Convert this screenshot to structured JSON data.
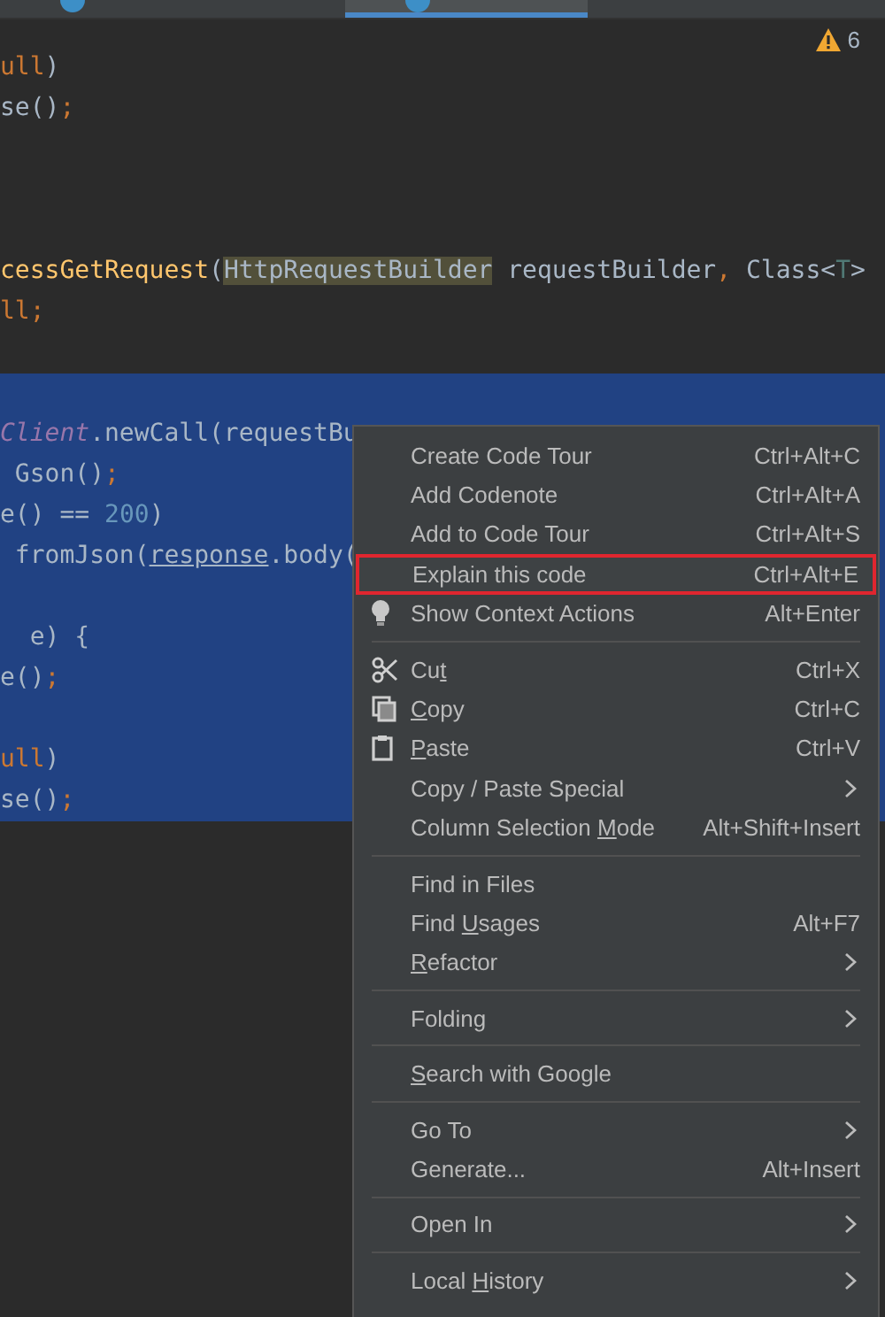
{
  "tabs": [
    {
      "selected": false
    },
    {
      "selected": true
    }
  ],
  "inspections": {
    "count": "6"
  },
  "editor": {
    "lines": [
      {
        "selected": false,
        "segments": [
          {
            "t": "ull",
            "kind": "keyword"
          },
          {
            "t": ")",
            "kind": "plain"
          }
        ]
      },
      {
        "selected": false,
        "segments": [
          {
            "t": "se()",
            "kind": "plain"
          },
          {
            "t": ";",
            "kind": "keyword"
          }
        ]
      },
      {
        "selected": false
      },
      {
        "selected": false
      },
      {
        "selected": false
      },
      {
        "selected": false,
        "segments": [
          {
            "t": "cessGetRequest",
            "kind": "method"
          },
          {
            "t": "(",
            "kind": "plain"
          },
          {
            "t": "HttpRequestBuilder",
            "kind": "highlight"
          },
          {
            "t": " requestBuilder",
            "kind": "plain"
          },
          {
            "t": ",",
            "kind": "keyword"
          },
          {
            "t": " Class<",
            "kind": "plain"
          },
          {
            "t": "T",
            "kind": "typeparam"
          },
          {
            "t": ">",
            "kind": "plain"
          }
        ]
      },
      {
        "selected": false,
        "segments": [
          {
            "t": "ll;",
            "kind": "keyword"
          }
        ]
      },
      {
        "selected": false
      },
      {
        "selected": true
      },
      {
        "selected": true,
        "segments": [
          {
            "t": "Client",
            "kind": "field"
          },
          {
            "t": ".newCall(requestBu",
            "kind": "plain"
          }
        ]
      },
      {
        "selected": true,
        "segments": [
          {
            "t": " Gson()",
            "kind": "plain"
          },
          {
            "t": ";",
            "kind": "keyword"
          }
        ]
      },
      {
        "selected": true,
        "segments": [
          {
            "t": "e() == ",
            "kind": "plain"
          },
          {
            "t": "200",
            "kind": "number"
          },
          {
            "t": ")",
            "kind": "plain"
          }
        ]
      },
      {
        "selected": true,
        "segments": [
          {
            "t": " fromJson(",
            "kind": "plain"
          },
          {
            "t": "response",
            "kind": "underlined"
          },
          {
            "t": ".body(",
            "kind": "plain"
          }
        ]
      },
      {
        "selected": true
      },
      {
        "selected": true,
        "segments": [
          {
            "t": "  e) {",
            "kind": "plain"
          }
        ]
      },
      {
        "selected": true,
        "segments": [
          {
            "t": "e()",
            "kind": "plain"
          },
          {
            "t": ";",
            "kind": "keyword"
          }
        ]
      },
      {
        "selected": true
      },
      {
        "selected": true,
        "segments": [
          {
            "t": "ull",
            "kind": "keyword"
          },
          {
            "t": ")",
            "kind": "plain"
          }
        ]
      },
      {
        "selected": true,
        "segments": [
          {
            "t": "se()",
            "kind": "plain"
          },
          {
            "t": ";",
            "kind": "keyword"
          }
        ]
      }
    ]
  },
  "context_menu": {
    "items": [
      {
        "kind": "item",
        "label": {
          "pre": "Create Code Tour"
        },
        "shortcut": "Ctrl+Alt+C",
        "submenu": false,
        "framed": false
      },
      {
        "kind": "item",
        "label": {
          "pre": "Add Codenote"
        },
        "shortcut": "Ctrl+Alt+A",
        "submenu": false,
        "framed": false
      },
      {
        "kind": "item",
        "label": {
          "pre": "Add to Code Tour"
        },
        "shortcut": "Ctrl+Alt+S",
        "submenu": false,
        "framed": false
      },
      {
        "kind": "item",
        "label": {
          "pre": "Explain this code"
        },
        "shortcut": "Ctrl+Alt+E",
        "submenu": false,
        "framed": true
      },
      {
        "kind": "bulb",
        "label": {
          "pre": "Show Context Actions"
        },
        "shortcut": "Alt+Enter",
        "submenu": false,
        "framed": false
      },
      {
        "kind": "separator"
      },
      {
        "kind": "scissors",
        "label": {
          "pre": "Cu",
          "key": "t"
        },
        "shortcut": "Ctrl+X",
        "submenu": false,
        "framed": false
      },
      {
        "kind": "copy",
        "label": {
          "key": "C",
          "post": "opy"
        },
        "shortcut": "Ctrl+C",
        "submenu": false,
        "framed": false
      },
      {
        "kind": "paste",
        "label": {
          "key": "P",
          "post": "aste"
        },
        "shortcut": "Ctrl+V",
        "submenu": false,
        "framed": false
      },
      {
        "kind": "item",
        "label": {
          "pre": "Copy / Paste Special"
        },
        "submenu": true,
        "framed": false
      },
      {
        "kind": "item",
        "label": {
          "pre": "Column Selection ",
          "key": "M",
          "post": "ode"
        },
        "shortcut": "Alt+Shift+Insert",
        "submenu": false,
        "framed": false
      },
      {
        "kind": "separator"
      },
      {
        "kind": "item",
        "label": {
          "pre": "Find in Files"
        },
        "submenu": false,
        "framed": false
      },
      {
        "kind": "item",
        "label": {
          "pre": "Find ",
          "key": "U",
          "post": "sages"
        },
        "shortcut": "Alt+F7",
        "submenu": false,
        "framed": false
      },
      {
        "kind": "item",
        "label": {
          "key": "R",
          "post": "efactor"
        },
        "submenu": true,
        "framed": false
      },
      {
        "kind": "separator"
      },
      {
        "kind": "item",
        "label": {
          "pre": "Folding"
        },
        "submenu": true,
        "framed": false
      },
      {
        "kind": "separator"
      },
      {
        "kind": "item",
        "label": {
          "key": "S",
          "post": "earch with Google"
        },
        "submenu": false,
        "framed": false
      },
      {
        "kind": "separator"
      },
      {
        "kind": "item",
        "label": {
          "pre": "Go To"
        },
        "submenu": true,
        "framed": false
      },
      {
        "kind": "item",
        "label": {
          "pre": "Generate..."
        },
        "shortcut": "Alt+Insert",
        "submenu": false,
        "framed": false
      },
      {
        "kind": "separator"
      },
      {
        "kind": "item",
        "label": {
          "pre": "Open In"
        },
        "submenu": true,
        "framed": false
      },
      {
        "kind": "separator"
      },
      {
        "kind": "item",
        "label": {
          "pre": "Local ",
          "key": "H",
          "post": "istory"
        },
        "submenu": true,
        "framed": false
      }
    ]
  }
}
